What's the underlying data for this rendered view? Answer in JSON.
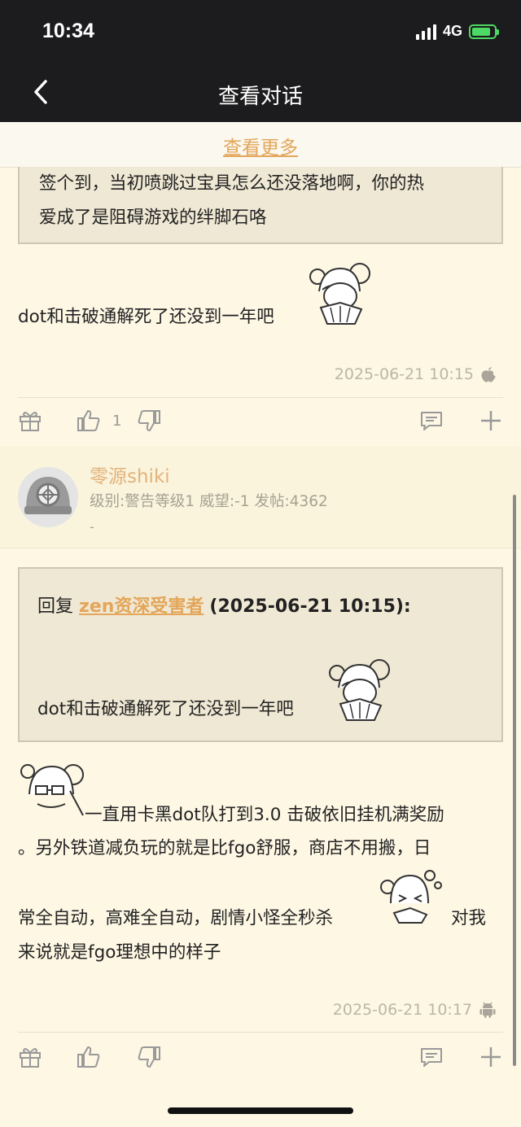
{
  "status": {
    "time": "10:34",
    "network": "4G"
  },
  "nav": {
    "title": "查看对话"
  },
  "more": {
    "label": "查看更多"
  },
  "post1": {
    "quote_line1": "签个到，当初喷跳过宝具怎么还没落地啊，你的热",
    "quote_line2": "爱成了是阻碍游戏的绊脚石咯",
    "body": "dot和击破通解死了还没到一年吧",
    "timestamp": "2025-06-21 10:15",
    "platform_icon": "apple-icon",
    "like_count": "1"
  },
  "post2": {
    "username": "零源shiki",
    "meta": "级别:警告等级1   威望:-1   发帖:4362",
    "signature": "-",
    "reply_prefix": "回复",
    "reply_user": "zen资深受害者",
    "reply_time": "(2025-06-21 10:15):",
    "quote_body": "dot和击破通解死了还没到一年吧",
    "line1": "一直用卡黑dot队打到3.0 击破依旧挂机满奖励",
    "line2": "。另外铁道减负玩的就是比fgo舒服，商店不用搬，日",
    "line3": "常全自动，高难全自动，剧情小怪全秒杀",
    "line3b": "对我",
    "line4": "来说就是fgo理想中的样子",
    "timestamp": "2025-06-21 10:17",
    "platform_icon": "android-icon"
  },
  "colors": {
    "accent": "#e3a65a",
    "background": "#fdf7e4",
    "quote_bg": "#efe8d4"
  }
}
